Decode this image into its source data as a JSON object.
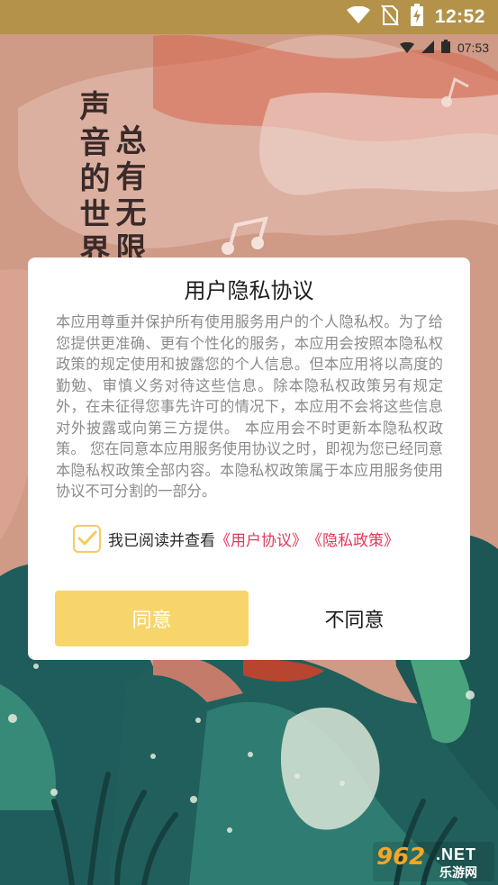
{
  "status_bar": {
    "time": "12:52",
    "icons": [
      "wifi-icon",
      "no-sim-icon",
      "battery-charging-icon"
    ]
  },
  "app_status_bar": {
    "time": "07:53",
    "icons": [
      "wifi-icon",
      "signal-icon",
      "battery-icon"
    ]
  },
  "background": {
    "poem_col1": "声音的世界",
    "poem_col2": "总有无限"
  },
  "dialog": {
    "title": "用户隐私协议",
    "body": "本应用尊重并保护所有使用服务用户的个人隐私权。为了给您提供更准确、更有个性化的服务，本应用会按照本隐私权政策的规定使用和披露您的个人信息。但本应用将以高度的勤勉、审慎义务对待这些信息。除本隐私权政策另有规定外，在未征得您事先许可的情况下，本应用不会将这些信息对外披露或向第三方提供。 本应用会不时更新本隐私权政策。 您在同意本应用服务使用协议之时，即视为您已经同意本隐私权政策全部内容。本隐私权政策属于本应用服务使用协议不可分割的一部分。",
    "consent_text": "我已阅读并查看",
    "user_agreement_link": "《用户协议》",
    "privacy_policy_link": "《隐私政策》",
    "checkbox_checked": true,
    "agree_label": "同意",
    "disagree_label": "不同意"
  },
  "watermark": {
    "number": "962",
    "domain": ".NET",
    "chinese": "乐游网"
  },
  "colors": {
    "status_bar_bg": "#b4924a",
    "accent_yellow": "#f8d56b",
    "link_red": "#e2375b",
    "body_gray": "#8a8a8a",
    "teal": "#1f5d5c"
  }
}
